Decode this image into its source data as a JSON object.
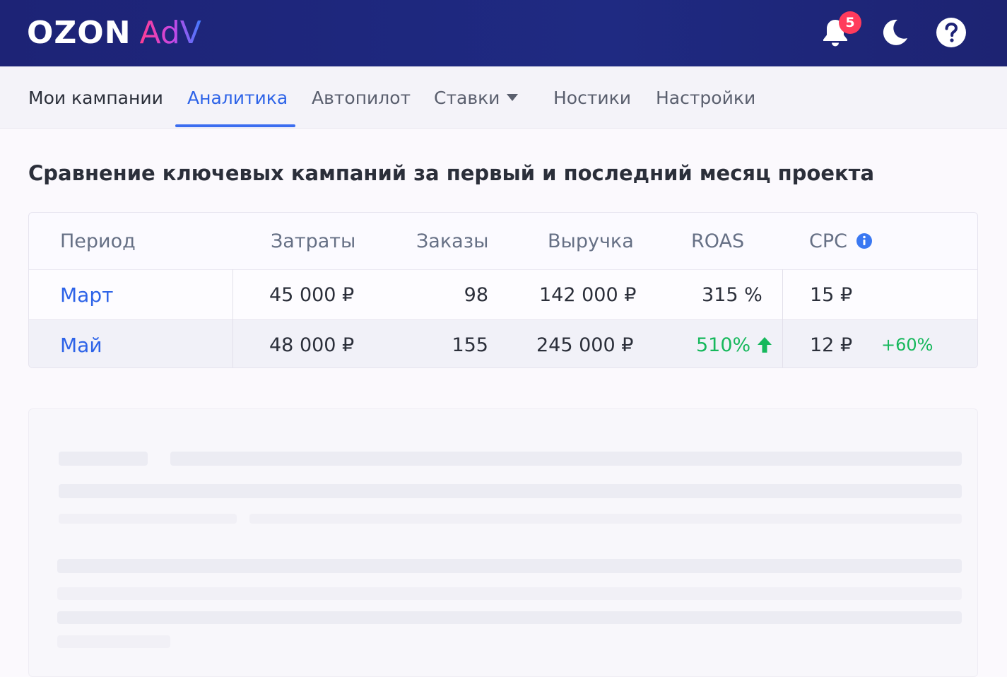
{
  "header": {
    "logo": {
      "ozon": "OZON",
      "adv": "AdV"
    },
    "notifications_count": "5",
    "icons": [
      "bell-icon",
      "moon-icon",
      "help-icon"
    ]
  },
  "nav": {
    "items": [
      {
        "label": "Мои кампании"
      },
      {
        "label": "Аналитика",
        "active": true
      },
      {
        "label": "Автопилот"
      },
      {
        "label": "Ставки"
      },
      {
        "label": "Ностики"
      },
      {
        "label": "Настройки"
      }
    ]
  },
  "main": {
    "title": "Сравнение ключевых кампаний за первый и последний месяц проекта",
    "table": {
      "headers": [
        "Период",
        "Затраты",
        "Заказы",
        "Выручка",
        "ROAS",
        "CPC"
      ],
      "rows": [
        {
          "period": "Март",
          "spend": "45 000 ₽",
          "orders": "98",
          "revenue": "142 000 ₽",
          "roas": "315 %",
          "cpc": "15 ₽",
          "cpc_change": ""
        },
        {
          "period": "Май",
          "spend": "48 000 ₽",
          "orders": "155",
          "revenue": "245 000 ₽",
          "roas": "510%",
          "cpc": "12 ₽",
          "cpc_change": "+60%"
        }
      ]
    }
  },
  "colors": {
    "header_bg": "#1d2376",
    "accent": "#2d63e8",
    "positive": "#16b85c",
    "badge": "#ff3b5c"
  }
}
